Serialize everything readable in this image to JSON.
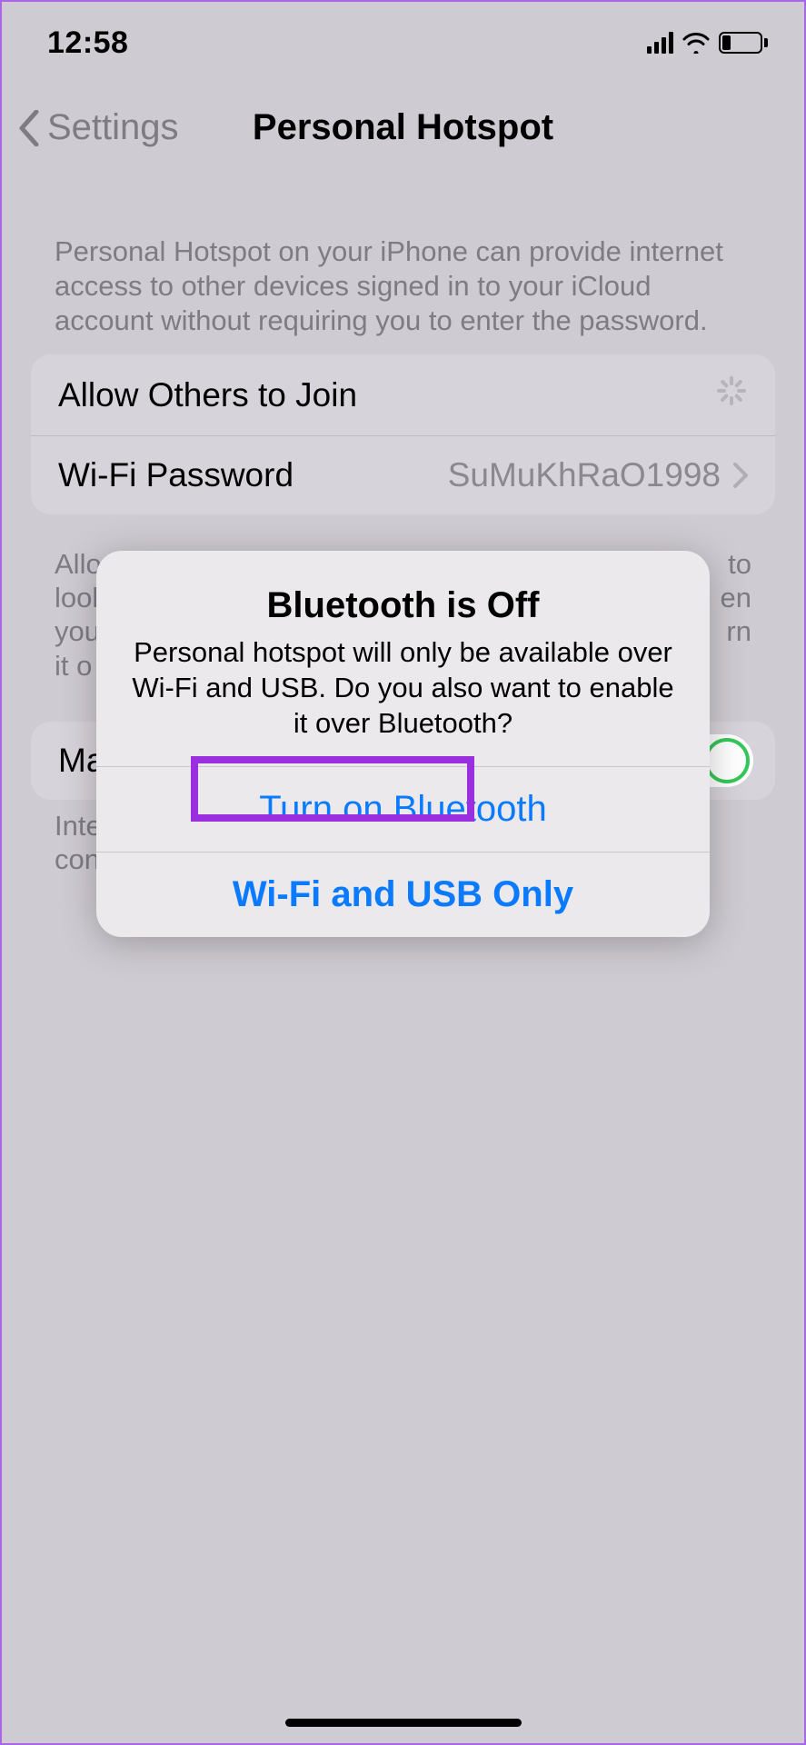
{
  "status": {
    "time": "12:58"
  },
  "nav": {
    "back_label": "Settings",
    "title": "Personal Hotspot"
  },
  "description": "Personal Hotspot on your iPhone can provide internet access to other devices signed in to your iCloud account without requiring you to enter the password.",
  "rows": {
    "allow_others": "Allow Others to Join",
    "wifi_pw_label": "Wi-Fi Password",
    "wifi_pw_value": "SuMuKhRaO1998"
  },
  "allow_footer_front": "Allo",
  "allow_footer_tail_1": "to",
  "allow_footer_line2_front": "look",
  "allow_footer_line2_tail": "en",
  "allow_footer_line3_front": "you",
  "allow_footer_line3_tail": "rn",
  "allow_footer_line4_front": "it o",
  "row2_label_front": "Ma",
  "footer2_line1_front": "Inte",
  "footer2_line2_front": "con",
  "alert": {
    "title": "Bluetooth is Off",
    "message": "Personal hotspot will only be available over Wi-Fi and USB. Do you also want to enable it over Bluetooth?",
    "btn_primary": "Turn on Bluetooth",
    "btn_secondary": "Wi-Fi and USB Only"
  }
}
